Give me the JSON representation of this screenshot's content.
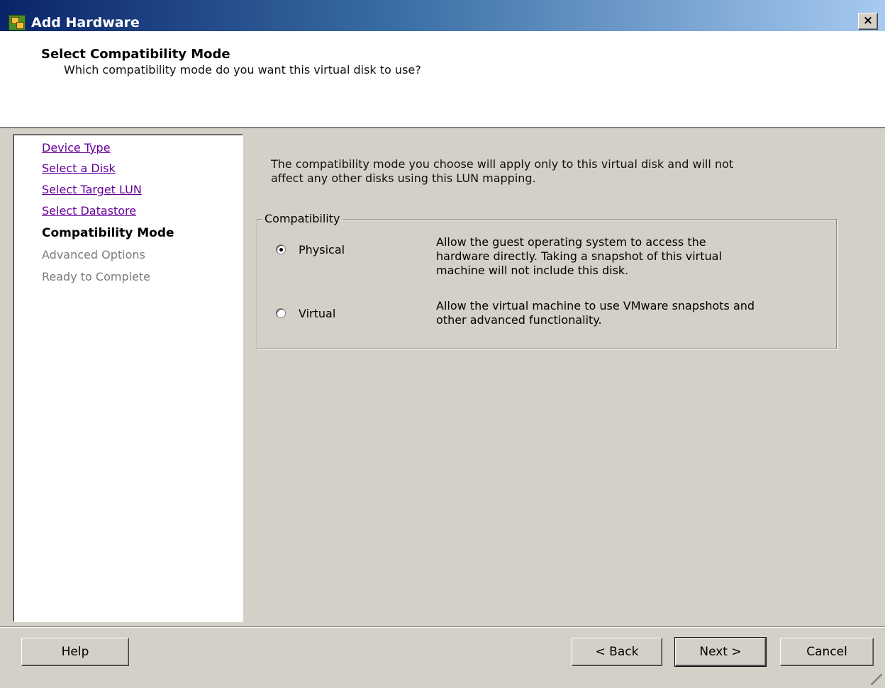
{
  "window": {
    "title": "Add Hardware",
    "close_label": "×"
  },
  "header": {
    "title": "Select Compatibility Mode",
    "subtitle": "Which compatibility mode do you want this virtual disk to use?"
  },
  "steps": [
    {
      "label": "Device Type",
      "state": "link"
    },
    {
      "label": "Select a Disk",
      "state": "link"
    },
    {
      "label": "Select Target LUN",
      "state": "link"
    },
    {
      "label": "Select Datastore",
      "state": "link"
    },
    {
      "label": "Compatibility Mode",
      "state": "current"
    },
    {
      "label": "Advanced Options",
      "state": "disabled"
    },
    {
      "label": "Ready to Complete",
      "state": "disabled"
    }
  ],
  "content": {
    "intro_line1": "The compatibility mode you choose will apply only to this virtual disk and will not",
    "intro_line2": "affect any other disks using this LUN mapping.",
    "group_label": "Compatibility",
    "options": [
      {
        "label": "Physical",
        "selected": true,
        "desc": [
          "Allow the guest operating system to access the",
          "hardware directly. Taking a snapshot of this virtual",
          "machine will not include this disk."
        ]
      },
      {
        "label": "Virtual",
        "selected": false,
        "desc": [
          "Allow the virtual machine to use VMware snapshots and",
          "other advanced functionality."
        ]
      }
    ]
  },
  "footer": {
    "help_label": "Help",
    "back_label": "< Back",
    "next_label": "Next >",
    "cancel_label": "Cancel"
  }
}
